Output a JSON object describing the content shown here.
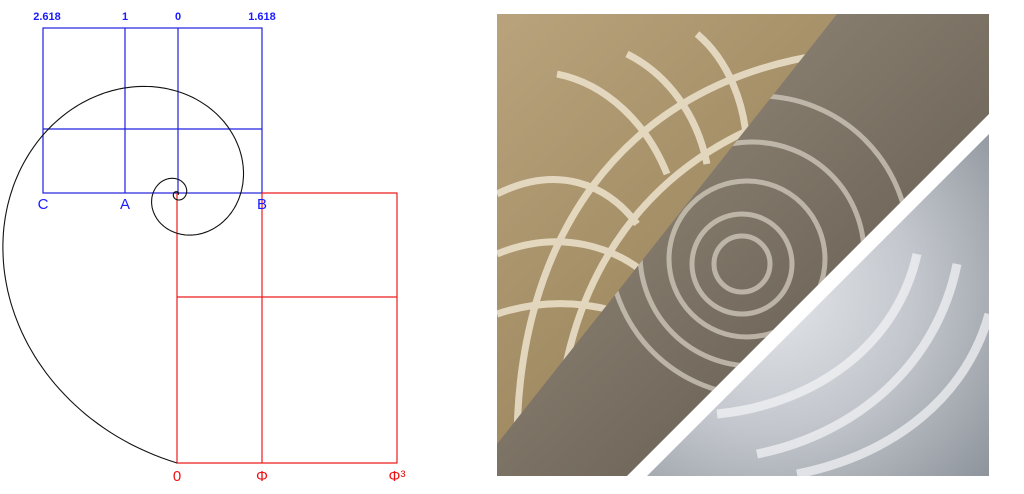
{
  "diagram": {
    "top_labels": [
      "2.618",
      "1",
      "0",
      "1.618"
    ],
    "point_labels": [
      "C",
      "A",
      "B"
    ],
    "bottom_labels": [
      "0",
      "Φ",
      "Φ³"
    ],
    "colors": {
      "blue_grid": "#2020e0",
      "red_grid": "#ee1c1c",
      "spiral": "#111111",
      "label_blue": "#1a1aff",
      "label_red": "#ee1111"
    }
  },
  "photo": {
    "subject": "nautilus-shell-and-hurricane-collage"
  }
}
